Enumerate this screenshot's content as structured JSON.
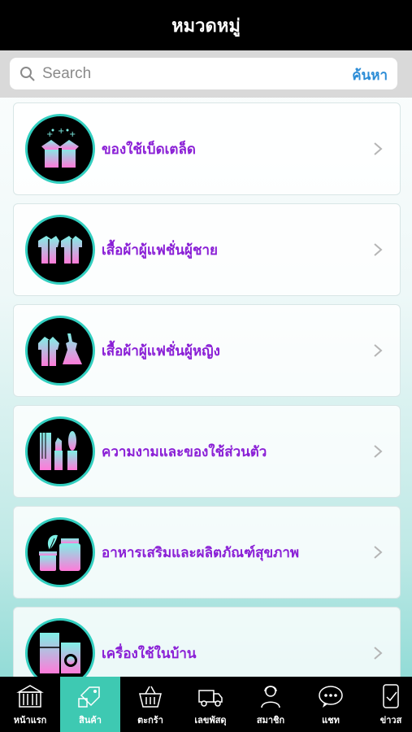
{
  "header": {
    "title": "หมวดหมู่"
  },
  "search": {
    "placeholder": "Search",
    "button_label": "ค้นหา"
  },
  "categories": [
    {
      "label": "ของใช้เบ็ดเตล็ด",
      "icon": "gift-box-icon"
    },
    {
      "label": "เสื้อผ้าผู้แฟชั่นผู้ชาย",
      "icon": "men-clothing-icon"
    },
    {
      "label": "เสื้อผ้าผู้แฟชั่นผู้หญิง",
      "icon": "women-clothing-icon"
    },
    {
      "label": "ความงามและของใช้ส่วนตัว",
      "icon": "beauty-icon"
    },
    {
      "label": "อาหารเสริมและผลิตภัณฑ์สุขภาพ",
      "icon": "supplement-icon"
    },
    {
      "label": "เครื่องใช้ในบ้าน",
      "icon": "household-appliance-icon"
    }
  ],
  "tabs": [
    {
      "label": "หน้าแรก",
      "icon": "building-icon"
    },
    {
      "label": "สินค้า",
      "icon": "product-tag-icon",
      "active": true
    },
    {
      "label": "ตะกร้า",
      "icon": "basket-icon"
    },
    {
      "label": "เลขพัสดุ",
      "icon": "delivery-truck-icon"
    },
    {
      "label": "สมาชิก",
      "icon": "member-icon"
    },
    {
      "label": "แชท",
      "icon": "chat-icon"
    },
    {
      "label": "ข่าวส",
      "icon": "news-icon"
    }
  ],
  "colors": {
    "accent": "#3ec9b2",
    "label": "#8a1fd6",
    "search_button": "#2b8cd6"
  }
}
